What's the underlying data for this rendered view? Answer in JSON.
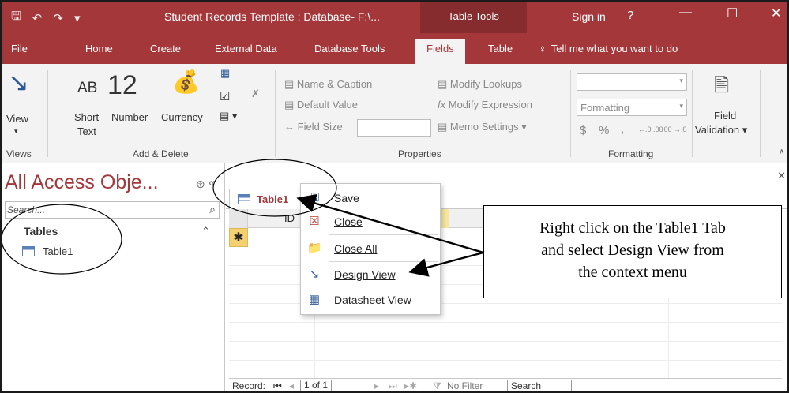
{
  "titlebar": {
    "save_icon": "save-icon",
    "undo_icon": "undo-icon",
    "redo_icon": "redo-icon",
    "customize_icon": "customize-qat-icon",
    "title": "Student Records Template : Database- F:\\...",
    "contextual_group": "Table Tools",
    "sign_in": "Sign in",
    "help": "?",
    "colors": {
      "accent": "#a4373a",
      "contextual": "#862b2e"
    }
  },
  "ribbon_tabs": {
    "items": [
      "File",
      "Home",
      "Create",
      "External Data",
      "Database Tools",
      "Fields",
      "Table"
    ],
    "active": "Fields",
    "tell_me": "Tell me what you want to do"
  },
  "ribbon": {
    "views": {
      "view_label": "View",
      "group": "Views"
    },
    "add_delete": {
      "short_text_glyph": "AB",
      "short_text_label_1": "Short",
      "short_text_label_2": "Text",
      "number_glyph": "12",
      "number_label": "Number",
      "currency_label": "Currency",
      "group": "Add & Delete"
    },
    "properties": {
      "name_caption": "Name & Caption",
      "default_value": "Default Value",
      "field_size": "Field Size",
      "modify_lookups": "Modify Lookups",
      "modify_expression": "Modify Expression",
      "memo_settings": "Memo Settings",
      "group": "Properties"
    },
    "formatting": {
      "format_value": "Formatting",
      "currency_symbol": "$",
      "percent_symbol": "%",
      "comma_symbol": ",",
      "increase_decimals": "←.0 .00",
      "decrease_decimals": ".00 →.0",
      "group": "Formatting"
    },
    "field_validation": {
      "label_1": "Field",
      "label_2": "Validation"
    }
  },
  "nav_pane": {
    "title": "All Access Obje...",
    "search_placeholder": "Search...",
    "group": "Tables",
    "items": [
      "Table1"
    ]
  },
  "document": {
    "tab_label": "Table1",
    "column_header": "ID",
    "new_row_marker": "✱",
    "record_nav": {
      "label": "Record:",
      "position": "1 of 1",
      "filter": "No Filter",
      "search": "Search"
    }
  },
  "context_menu": {
    "items": [
      {
        "label": "Save",
        "icon": "save-icon"
      },
      {
        "label": "Close",
        "icon": "close-icon"
      },
      {
        "label": "Close All",
        "icon": "close-all-icon"
      },
      {
        "label": "Design View",
        "icon": "design-view-icon"
      },
      {
        "label": "Datasheet View",
        "icon": "datasheet-view-icon"
      }
    ]
  },
  "callout": {
    "line1": "Right click on the Table1 Tab",
    "line2": "and select Design View from",
    "line3": "the context menu"
  }
}
